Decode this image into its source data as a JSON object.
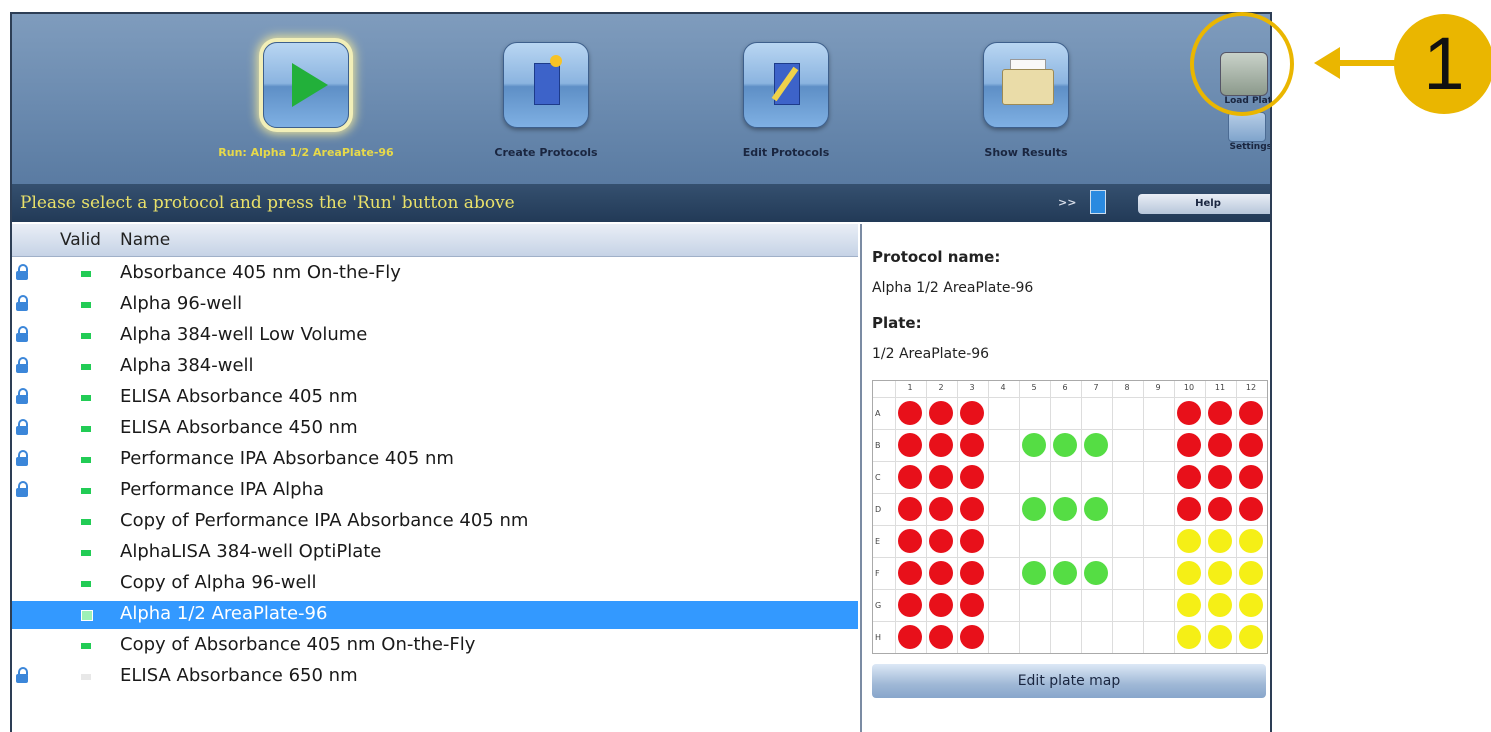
{
  "toolbar": {
    "buttons": [
      {
        "label": "Run: Alpha 1/2 AreaPlate-96",
        "icon": "play-icon",
        "active": true
      },
      {
        "label": "Create Protocols",
        "icon": "create-protocol-icon"
      },
      {
        "label": "Edit Protocols",
        "icon": "edit-protocol-icon"
      },
      {
        "label": "Show Results",
        "icon": "folder-icon"
      }
    ],
    "load_plate_label": "Load Plat",
    "settings_label": "Settings"
  },
  "infobar": {
    "message": "Please select a protocol and press the 'Run' button above",
    "arrows": ">>",
    "help_label": "Help"
  },
  "list": {
    "columns": {
      "valid": "Valid",
      "name": "Name"
    },
    "rows": [
      {
        "name": "Absorbance 405 nm On-the-Fly",
        "locked": true,
        "valid": true
      },
      {
        "name": "Alpha 96-well",
        "locked": true,
        "valid": true
      },
      {
        "name": "Alpha 384-well Low Volume",
        "locked": true,
        "valid": true
      },
      {
        "name": "Alpha 384-well",
        "locked": true,
        "valid": true
      },
      {
        "name": "ELISA Absorbance 405 nm",
        "locked": true,
        "valid": true
      },
      {
        "name": "ELISA Absorbance 450 nm",
        "locked": true,
        "valid": true
      },
      {
        "name": "Performance IPA Absorbance 405 nm",
        "locked": true,
        "valid": true
      },
      {
        "name": "Performance IPA Alpha",
        "locked": true,
        "valid": true
      },
      {
        "name": "Copy of Performance IPA Absorbance 405 nm",
        "locked": false,
        "valid": true
      },
      {
        "name": "AlphaLISA 384-well OptiPlate",
        "locked": false,
        "valid": true
      },
      {
        "name": "Copy of Alpha 96-well",
        "locked": false,
        "valid": true
      },
      {
        "name": "Alpha 1/2 AreaPlate-96",
        "locked": false,
        "valid": true,
        "selected": true
      },
      {
        "name": "Copy of Absorbance 405 nm On-the-Fly",
        "locked": false,
        "valid": true
      },
      {
        "name": "ELISA Absorbance 650 nm",
        "locked": true,
        "valid": false
      }
    ]
  },
  "detail": {
    "protocol_label": "Protocol name:",
    "protocol_value": "Alpha 1/2 AreaPlate-96",
    "plate_label": "Plate:",
    "plate_value": "1/2 AreaPlate-96",
    "edit_plate_map_label": "Edit plate map"
  },
  "plate_map": {
    "col_labels": [
      "1",
      "2",
      "3",
      "4",
      "5",
      "6",
      "7",
      "8",
      "9",
      "10",
      "11",
      "12"
    ],
    "row_labels": [
      "A",
      "B",
      "C",
      "D",
      "E",
      "F",
      "G",
      "H"
    ],
    "colors": {
      "R": "#e8101a",
      "G": "#55dd44",
      "Y": "#f5ef16"
    },
    "wells": [
      "RRR......RRR",
      "RRR.GGG..RRR",
      "RRR......RRR",
      "RRR.GGG..RRR",
      "RRR......YYY",
      "RRR.GGG..YYY",
      "RRR......YYY",
      "RRR......YYY"
    ]
  },
  "callout": {
    "number": "1",
    "color": "#eab600"
  }
}
